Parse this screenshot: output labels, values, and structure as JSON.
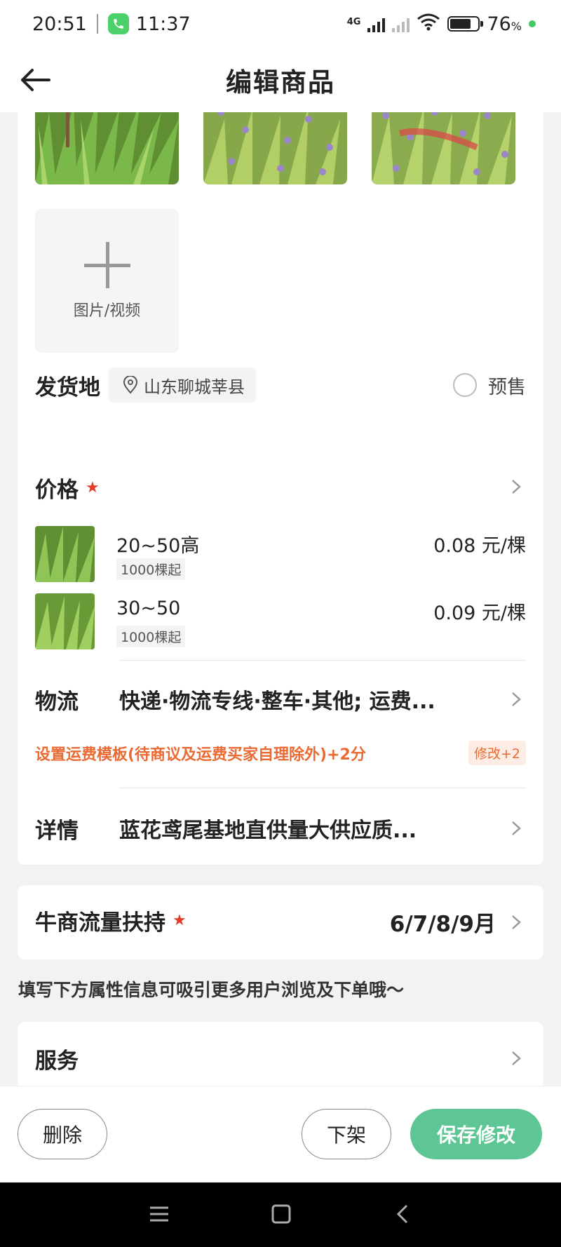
{
  "status": {
    "time1": "20:51",
    "time2": "11:37",
    "net": "4G",
    "battery": "76",
    "battery_unit": "%"
  },
  "header": {
    "title": "编辑商品"
  },
  "media": {
    "add_label": "图片/视频"
  },
  "shipping": {
    "label": "发货地",
    "location": "山东聊城莘县",
    "presale_label": "预售"
  },
  "price": {
    "title": "价格",
    "items": [
      {
        "spec": "20~50高",
        "min_qty": "1000棵起",
        "price": "0.08 元/棵"
      },
      {
        "spec": "30~50",
        "min_qty": "1000棵起",
        "price": "0.09 元/棵"
      }
    ]
  },
  "logistics": {
    "label": "物流",
    "value": "快递·物流专线·整车·其他; 运费...",
    "tip": "设置运费模板(待商议及运费买家自理除外)+2分",
    "tip_badge": "修改+2"
  },
  "details": {
    "label": "详情",
    "value": "蓝花鸢尾基地直供量大供应质..."
  },
  "traffic": {
    "label": "牛商流量扶持",
    "value": "6/7/8/9月"
  },
  "hint": "填写下方属性信息可吸引更多用户浏览及下单哦～",
  "service": {
    "label": "服务"
  },
  "actions": {
    "delete": "删除",
    "unlist": "下架",
    "save": "保存修改"
  },
  "colors": {
    "accent_green": "#5ec595",
    "tip_orange": "#ea6a33",
    "required_red": "#e23c2b"
  }
}
